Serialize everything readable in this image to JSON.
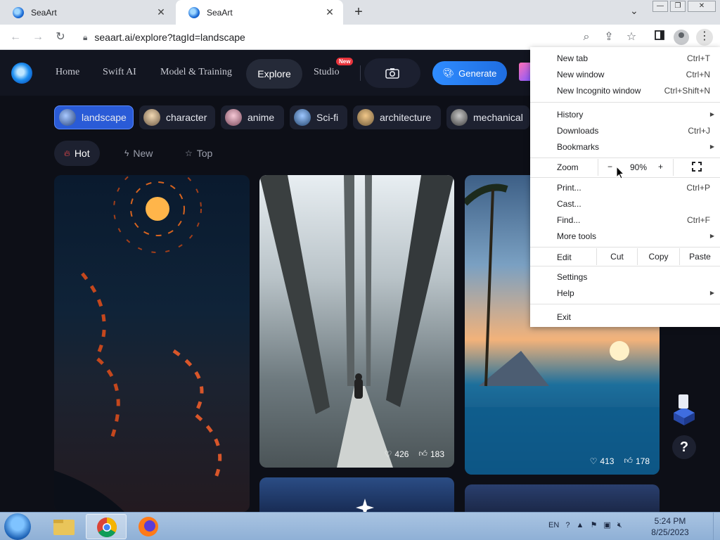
{
  "browser": {
    "tabs": [
      {
        "title": "SeaArt",
        "active": false
      },
      {
        "title": "SeaArt",
        "active": true
      }
    ],
    "new_tab_symbol": "+",
    "url": "seaart.ai/explore?tagId=landscape"
  },
  "site": {
    "nav": [
      {
        "label": "Home"
      },
      {
        "label": "Swift AI"
      },
      {
        "label": "Model & Training"
      },
      {
        "label": "Explore"
      },
      {
        "label": "Studio"
      }
    ],
    "studio_badge": "New",
    "generate_label": "Generate",
    "tags": [
      {
        "label": "landscape",
        "selected": true
      },
      {
        "label": "character",
        "selected": false
      },
      {
        "label": "anime",
        "selected": false
      },
      {
        "label": "Sci-fi",
        "selected": false
      },
      {
        "label": "architecture",
        "selected": false
      },
      {
        "label": "mechanical",
        "selected": false
      }
    ],
    "sorts": [
      {
        "label": "Hot",
        "icon": "fire-icon"
      },
      {
        "label": "New",
        "icon": "bolt-icon"
      },
      {
        "label": "Top",
        "icon": "star-icon"
      }
    ],
    "cards": [
      {
        "likes": "426",
        "thumbs": "183"
      },
      {
        "likes": "413",
        "thumbs": "178"
      }
    ],
    "help_symbol": "?"
  },
  "menu": {
    "items": [
      {
        "label": "New tab",
        "shortcut": "Ctrl+T"
      },
      {
        "label": "New window",
        "shortcut": "Ctrl+N"
      },
      {
        "label": "New Incognito window",
        "shortcut": "Ctrl+Shift+N"
      },
      {
        "label": "History",
        "shortcut": ""
      },
      {
        "label": "Downloads",
        "shortcut": "Ctrl+J"
      },
      {
        "label": "Bookmarks",
        "shortcut": ""
      },
      {
        "label": "Print...",
        "shortcut": "Ctrl+P"
      },
      {
        "label": "Cast...",
        "shortcut": ""
      },
      {
        "label": "Find...",
        "shortcut": "Ctrl+F"
      },
      {
        "label": "More tools",
        "shortcut": ""
      },
      {
        "label": "Settings",
        "shortcut": ""
      },
      {
        "label": "Help",
        "shortcut": ""
      },
      {
        "label": "Exit",
        "shortcut": ""
      }
    ],
    "zoom": {
      "label": "Zoom",
      "minus": "−",
      "value": "90%",
      "plus": "+"
    },
    "edit": {
      "label": "Edit",
      "cut": "Cut",
      "copy": "Copy",
      "paste": "Paste"
    }
  },
  "taskbar": {
    "language": "EN",
    "time": "5:24 PM",
    "date": "8/25/2023"
  },
  "colors": {
    "accent": "#2a5bd7",
    "generate": "#2f8cff",
    "badge": "#e8343c",
    "page_bg": "#0d0f17"
  }
}
